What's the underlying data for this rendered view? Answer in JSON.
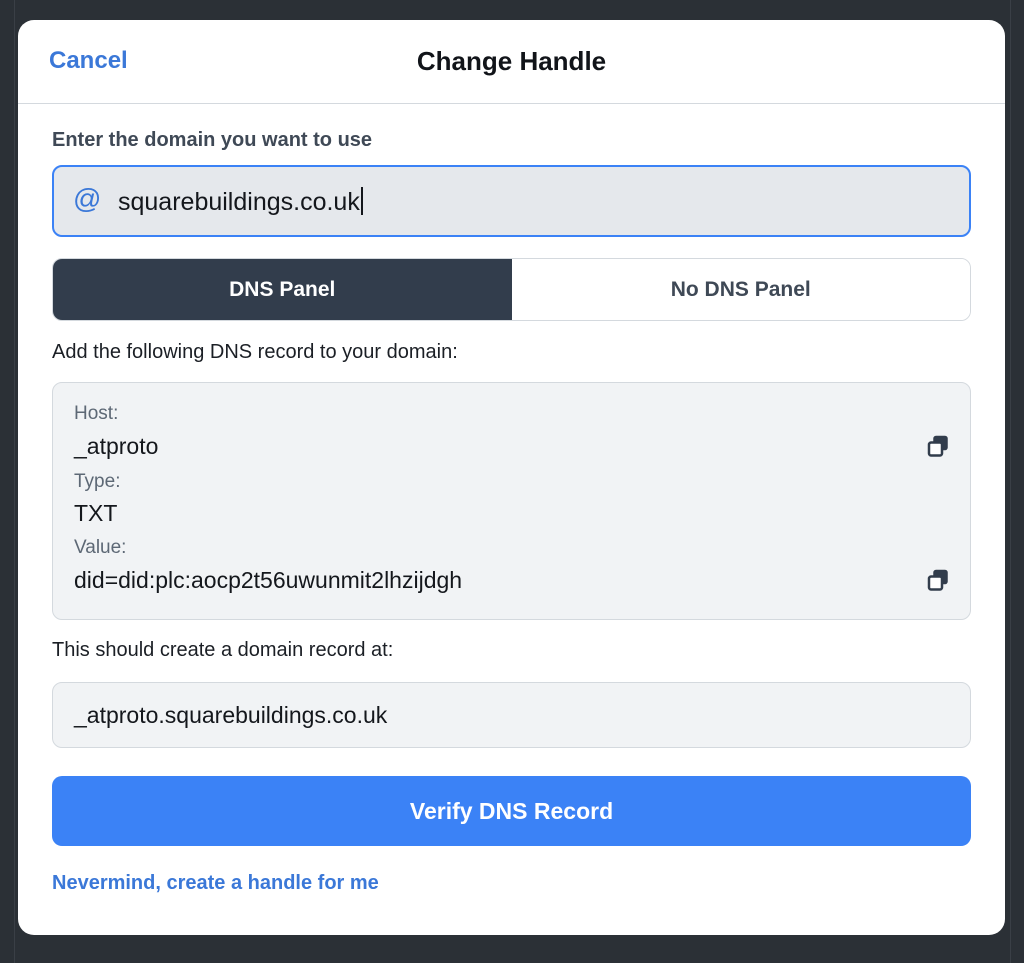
{
  "header": {
    "cancel_label": "Cancel",
    "title": "Change Handle"
  },
  "domain_field": {
    "label": "Enter the domain you want to use",
    "prefix_symbol": "@",
    "value": "squarebuildings.co.uk"
  },
  "tabs": [
    {
      "label": "DNS Panel",
      "selected": true
    },
    {
      "label": "No DNS Panel",
      "selected": false
    }
  ],
  "instructions": "Add the following DNS record to your domain:",
  "dns_record": {
    "host_label": "Host:",
    "host_value": "_atproto",
    "type_label": "Type:",
    "type_value": "TXT",
    "value_label": "Value:",
    "value_value": "did=did:plc:aocp2t56uwunmit2lhzijdgh",
    "copy_icon": "copy-icon"
  },
  "result": {
    "note": "This should create a domain record at:",
    "value": "_atproto.squarebuildings.co.uk"
  },
  "verify_button_label": "Verify DNS Record",
  "fallback_link_label": "Nevermind, create a handle for me",
  "colors": {
    "accent": "#3b82f6",
    "link": "#3b78d8",
    "segment_active": "#323d4c",
    "backdrop": "#2b3036"
  }
}
